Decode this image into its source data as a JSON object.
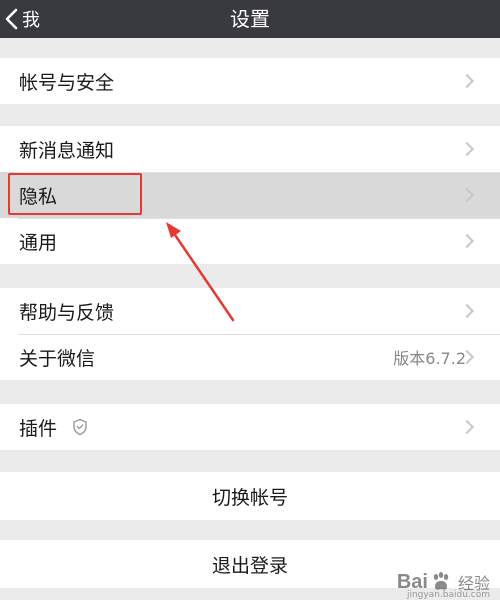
{
  "navbar": {
    "back_label": "我",
    "title": "设置"
  },
  "groups": [
    {
      "items": [
        {
          "label": "帐号与安全"
        }
      ]
    },
    {
      "items": [
        {
          "label": "新消息通知"
        },
        {
          "label": "隐私"
        },
        {
          "label": "通用"
        }
      ]
    },
    {
      "items": [
        {
          "label": "帮助与反馈"
        },
        {
          "label": "关于微信",
          "value": "版本6.7.2"
        }
      ]
    },
    {
      "items": [
        {
          "label": "插件"
        }
      ]
    }
  ],
  "actions": {
    "switch_account": "切换帐号",
    "logout": "退出登录"
  },
  "annotation": {
    "color": "#e53935",
    "highlighted_item": "隐私"
  },
  "watermark": {
    "text_left": "Bai",
    "text_right": "经验",
    "url": "jingyan.baidu.com"
  },
  "colors": {
    "navbar_bg": "#393a3f",
    "page_bg": "#ebebeb",
    "highlight_bg": "#d9d9d9"
  }
}
